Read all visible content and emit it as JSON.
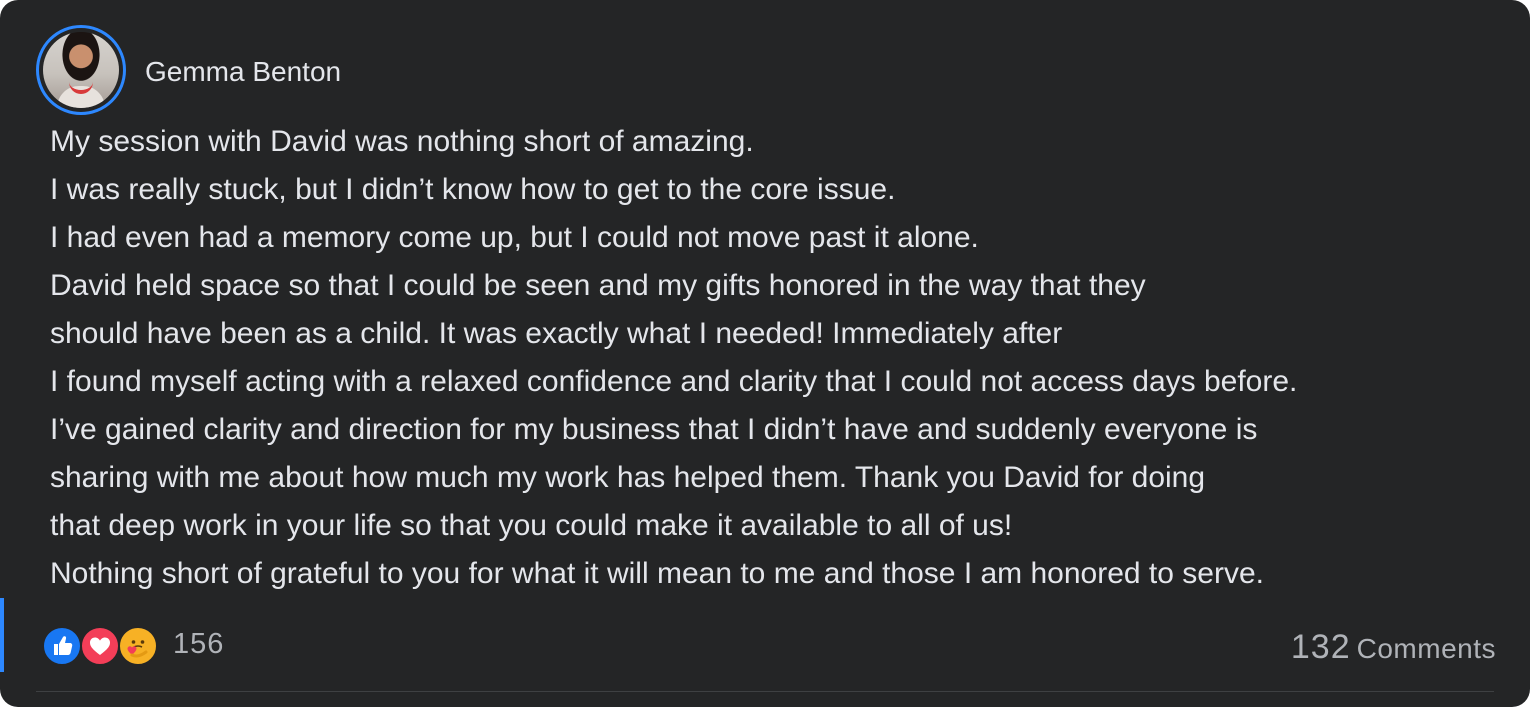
{
  "post": {
    "author": "Gemma Benton",
    "body_lines": [
      "My session with David was nothing short of amazing.",
      "I was really stuck, but I didn’t know how to get to the core issue.",
      "I had even had a memory come up, but I could not move past it alone.",
      "David held space so that I could be seen and my gifts honored in the way that they",
      "should have been as a child. It was exactly what I needed! Immediately after",
      "I found myself acting with a relaxed confidence and clarity that I could not access days before.",
      "I’ve gained clarity and direction for my business that I didn’t have and suddenly everyone is",
      "sharing with me about how much my work has helped them. Thank you David for doing",
      "that deep work in your life so that you could make it available to all of us!",
      "Nothing short of grateful to you for what it will mean to me and those I am honored to serve."
    ]
  },
  "reactions": {
    "icons": [
      "like-icon",
      "love-icon",
      "care-icon"
    ],
    "count": "156"
  },
  "comments": {
    "count": "132",
    "label": "Comments"
  },
  "colors": {
    "card_bg": "#242526",
    "text": "#e4e6eb",
    "secondary_text": "#b0b3b8",
    "accent": "#2d88ff",
    "like": "#1877f2",
    "love": "#f33e58",
    "care": "#f7b125"
  }
}
